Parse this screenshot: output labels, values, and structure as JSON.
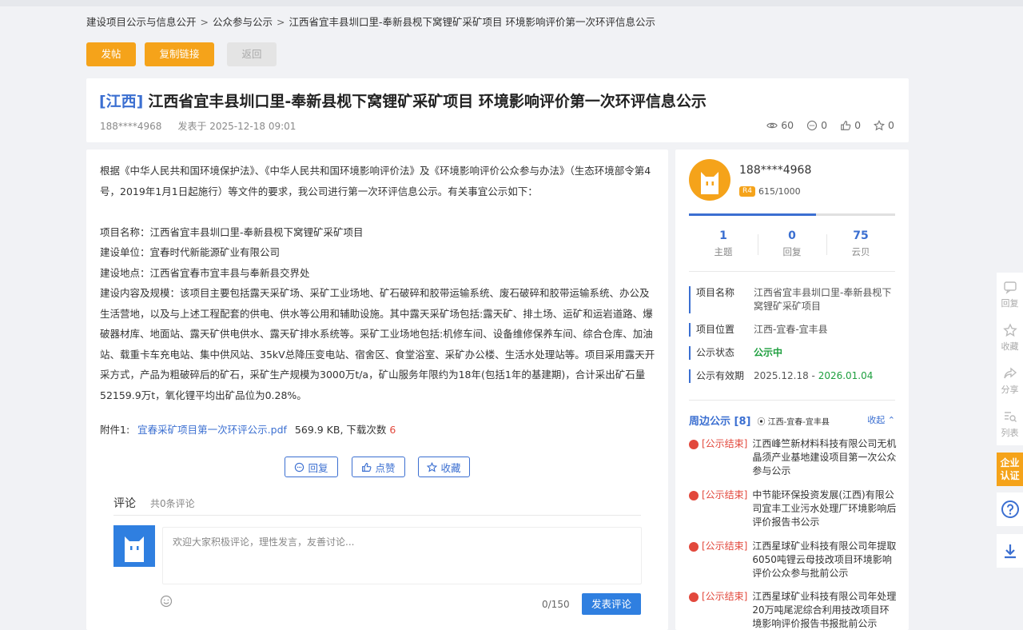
{
  "breadcrumb": [
    "建设项目公示与信息公开",
    "公众参与公示",
    "江西省宜丰县圳口里-奉新县枧下窝锂矿采矿项目 环境影响评价第一次环评信息公示"
  ],
  "toolbar": {
    "post": "发帖",
    "copy_link": "复制链接",
    "back": "返回"
  },
  "post": {
    "region": "[江西]",
    "title": "江西省宜丰县圳口里-奉新县枧下窝锂矿采矿项目 环境影响评价第一次环评信息公示",
    "author": "188****4968",
    "posted_at": "发表于 2025-12-18 09:01",
    "views": "60",
    "comments": "0",
    "likes": "0",
    "favorites": "0"
  },
  "content": {
    "intro": "根据《中华人民共和国环境保护法》、《中华人民共和国环境影响评价法》及《环境影响评价公众参与办法》（生态环境部令第4号，2019年1月1日起施行）等文件的要求，我公司进行第一次环评信息公示。有关事宜公示如下：",
    "project_name": "项目名称：江西省宜丰县圳口里-奉新县枧下窝锂矿采矿项目",
    "builder": "建设单位：宜春时代新能源矿业有限公司",
    "location": "建设地点：江西省宜春市宜丰县与奉新县交界处",
    "scope": "建设内容及规模：该项目主要包括露天采矿场、采矿工业场地、矿石破碎和胶带运输系统、废石破碎和胶带运输系统、办公及生活营地，以及与上述工程配套的供电、供水等公用和辅助设施。其中露天采矿场包括:露天矿、排土场、运矿和运岩道路、爆破器材库、地面站、露天矿供电供水、露天矿排水系统等。采矿工业场地包括:机修车间、设备维修保养车间、综合仓库、加油站、载重卡车充电站、集中供风站、35kV总降压变电站、宿舍区、食堂浴室、采矿办公楼、生活水处理站等。项目采用露天开采方式，产品为粗破碎后的矿石，采矿生产规模为3000万t/a，矿山服务年限约为18年(包括1年的基建期)，合计采出矿石量52159.9万t，氧化锂平均出矿品位为0.28%。"
  },
  "attachment": {
    "label": "附件1:",
    "file": "宜春采矿项目第一次环评公示.pdf",
    "size": "569.9 KB",
    "dl_label": ", 下载次数",
    "downloads": "6"
  },
  "actions": {
    "reply": "回复",
    "like": "点赞",
    "favorite": "收藏"
  },
  "comments": {
    "title": "评论",
    "count": "共0条评论",
    "placeholder": "欢迎大家积极评论，理性发言，友善讨论...",
    "counter": "0/150",
    "submit": "发表评论"
  },
  "user": {
    "name": "188****4968",
    "level": "R4",
    "points": "615/1000",
    "progress": 0.615,
    "stats": [
      {
        "num": "1",
        "label": "主题"
      },
      {
        "num": "0",
        "label": "回复"
      },
      {
        "num": "75",
        "label": "云贝"
      }
    ]
  },
  "project_info": [
    {
      "key": "项目名称",
      "value": "江西省宜丰县圳口里-奉新县枧下窝锂矿采矿项目"
    },
    {
      "key": "项目位置",
      "value": "江西-宜春-宜丰县"
    },
    {
      "key": "公示状态",
      "value": "公示中"
    },
    {
      "key": "公示有效期",
      "start": "2025.12.18",
      "sep": " - ",
      "end": "2026.01.04"
    }
  ],
  "nearby": {
    "title": "周边公示 [8]",
    "location": "江西-宜春-宜丰县",
    "collapse": "收起",
    "items": [
      {
        "tag": "[公示结束]",
        "text": "江西峰竺新材料科技有限公司无机晶须产业基地建设项目第一次公众参与公示"
      },
      {
        "tag": "[公示结束]",
        "text": "中节能环保投资发展(江西)有限公司宜丰工业污水处理厂环境影响后评价报告书公示"
      },
      {
        "tag": "[公示结束]",
        "text": "江西星球矿业科技有限公司年提取6050吨锂云母技改项目环境影响评价公众参与批前公示"
      },
      {
        "tag": "[公示结束]",
        "text": "江西星球矿业科技有限公司年处理20万吨尾泥综合利用技改项目环境影响评价报告书报批前公示"
      }
    ]
  },
  "float_bar": {
    "reply": "回复",
    "favorite": "收藏",
    "share": "分享",
    "list": "列表",
    "cert_line1": "企业",
    "cert_line2": "认证"
  },
  "colors": {
    "orange": "#f5a31a",
    "blue": "#3b6fd1",
    "red": "#e2483c",
    "green": "#1e9f3f"
  }
}
